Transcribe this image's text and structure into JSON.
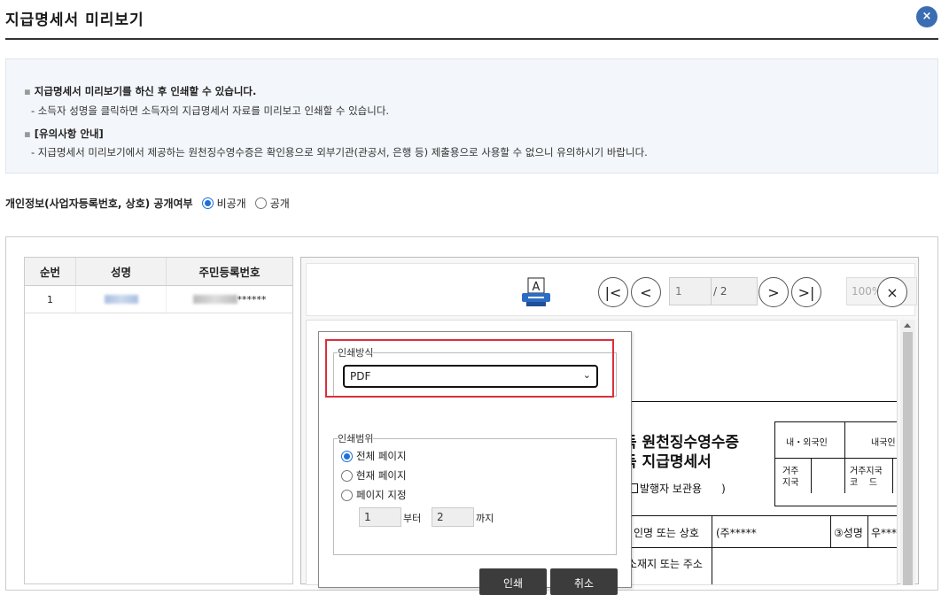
{
  "header": {
    "title": "지급명세서 미리보기",
    "close_glyph": "×"
  },
  "info": {
    "line1": "지급명세서 미리보기를 하신 후 인쇄할 수 있습니다.",
    "line2": "- 소득자 성명을 클릭하면 소득자의 지급명세서 자료를 미리보고 인쇄할 수 있습니다.",
    "line3": "[유의사항 안내]",
    "line4": "- 지급명세서 미리보기에서 제공하는 원천징수영수증은 확인용으로 외부기관(관공서, 은행 등) 제출용으로 사용할 수 없으니 유의하시기 바랍니다."
  },
  "privacy": {
    "label": "개인정보(사업자등록번호, 상호) 공개여부",
    "options": [
      "비공개",
      "공개"
    ],
    "selected": "비공개"
  },
  "table": {
    "columns": [
      "순번",
      "성명",
      "주민등록번호"
    ],
    "rows": [
      {
        "no": "1",
        "name": "",
        "id_suffix": "******"
      }
    ]
  },
  "viewer": {
    "page_current": "1",
    "page_total": "/ 2",
    "zoom": "100%",
    "icons": [
      "print-icon",
      "first-page-icon",
      "prev-page-icon",
      "next-page-icon",
      "last-page-icon",
      "close-icon"
    ],
    "nav": {
      "first": "|<",
      "prev": "<",
      "next": ">",
      "last": ">|",
      "close": "×"
    }
  },
  "document": {
    "title1": "득 원천징수영수증",
    "title2": "득 지급명세서",
    "keep": "발행자 보관용",
    "paren_close": ")",
    "foreign": "내・외국인",
    "domestic": "내국인",
    "res1": "거주",
    "res2": "지국",
    "res_code1": "거주지국",
    "res_code2": "코    드",
    "row1_label": "인명 또는 상호",
    "row1_value": "(주*****",
    "row1_label2": "③성명",
    "row1_value2": "우***",
    "row2_label": "소재지 또는 주소"
  },
  "print_dialog": {
    "method_legend": "인쇄방식",
    "method_value": "PDF",
    "range_legend": "인쇄범위",
    "range_options": [
      "전체 페이지",
      "현재 페이지",
      "페이지 지정"
    ],
    "range_selected": "전체 페이지",
    "from_value": "1",
    "from_suffix": "부터",
    "to_value": "2",
    "to_suffix": "까지",
    "print_button": "인쇄",
    "cancel_button": "취소"
  },
  "colors": {
    "accent": "#3b6db3",
    "highlight": "#d9303a",
    "radio": "#1e6fd9"
  }
}
